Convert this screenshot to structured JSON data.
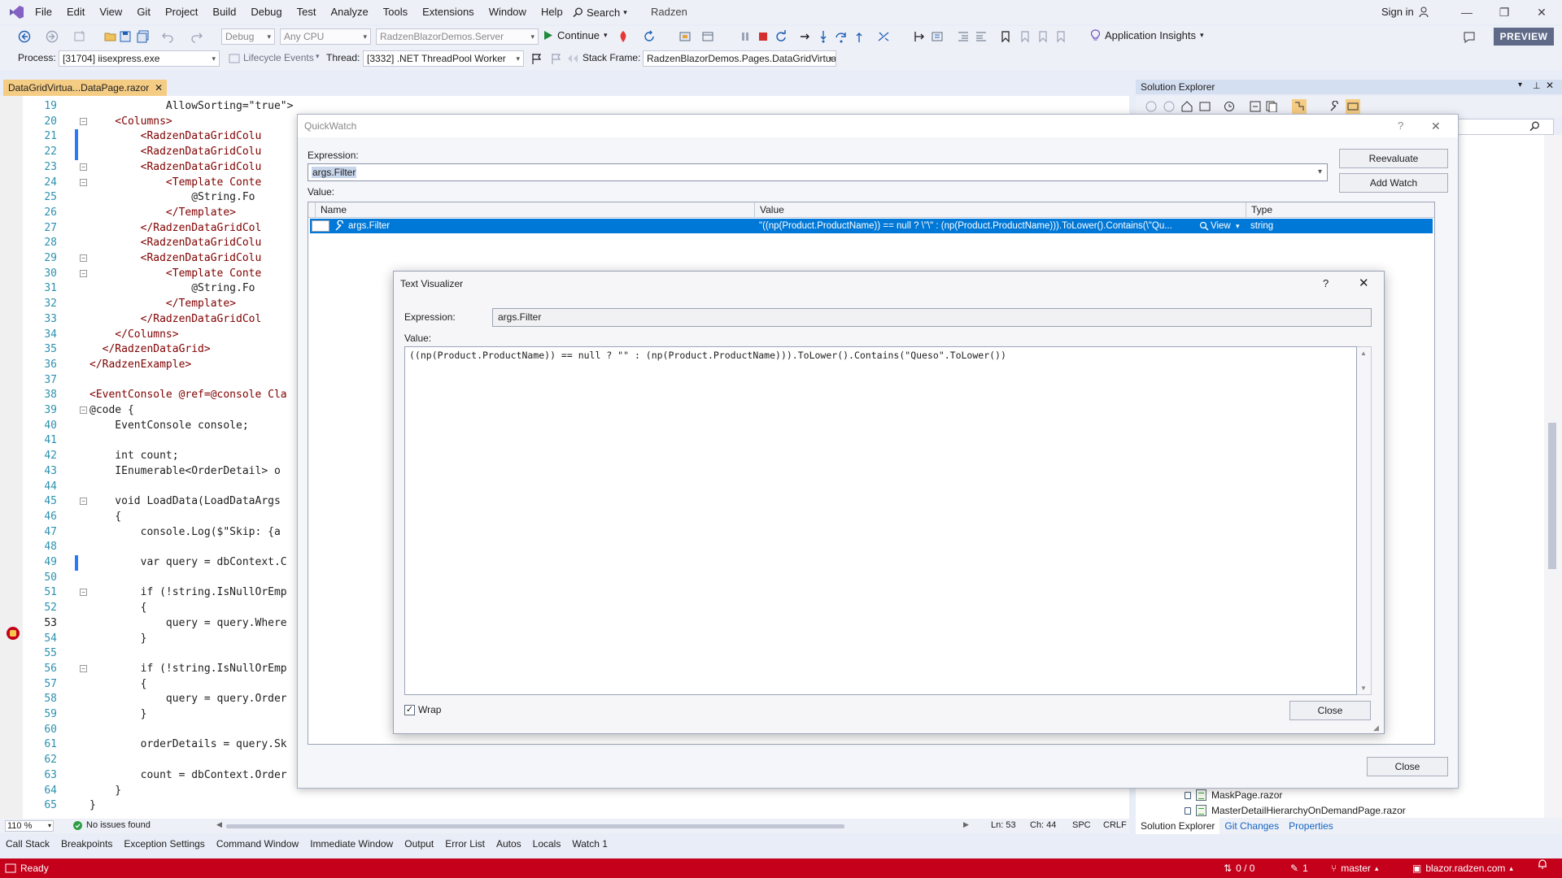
{
  "menubar": {
    "items": [
      "File",
      "Edit",
      "View",
      "Git",
      "Project",
      "Build",
      "Debug",
      "Test",
      "Analyze",
      "Tools",
      "Extensions",
      "Window",
      "Help"
    ],
    "search_label": "Search",
    "solution_name": "Radzen",
    "sign_in": "Sign in"
  },
  "toolbar1": {
    "config": "Debug",
    "platform": "Any CPU",
    "startup_project": "RadzenBlazorDemos.Server",
    "continue_label": "Continue",
    "app_insights": "Application Insights",
    "preview": "PREVIEW"
  },
  "toolbar2": {
    "process_label": "Process:",
    "process_value": "[31704] iisexpress.exe",
    "lifecycle": "Lifecycle Events",
    "thread_label": "Thread:",
    "thread_value": "[3332] .NET ThreadPool Worker",
    "stackframe_label": "Stack Frame:",
    "stackframe_value": "RadzenBlazorDemos.Pages.DataGridVirtua"
  },
  "editor": {
    "tab_title": "DataGridVirtua...DataPage.razor",
    "current_line": "53",
    "lines": [
      {
        "n": "19",
        "t": "            AllowSorting=\"true\">"
      },
      {
        "n": "20",
        "t": "    <Columns>"
      },
      {
        "n": "21",
        "t": "        <RadzenDataGridColu"
      },
      {
        "n": "22",
        "t": "        <RadzenDataGridColu"
      },
      {
        "n": "23",
        "t": "        <RadzenDataGridColu"
      },
      {
        "n": "24",
        "t": "            <Template Conte"
      },
      {
        "n": "25",
        "t": "                @String.Fo"
      },
      {
        "n": "26",
        "t": "            </Template>"
      },
      {
        "n": "27",
        "t": "        </RadzenDataGridCol"
      },
      {
        "n": "28",
        "t": "        <RadzenDataGridColu"
      },
      {
        "n": "29",
        "t": "        <RadzenDataGridColu"
      },
      {
        "n": "30",
        "t": "            <Template Conte"
      },
      {
        "n": "31",
        "t": "                @String.Fo"
      },
      {
        "n": "32",
        "t": "            </Template>"
      },
      {
        "n": "33",
        "t": "        </RadzenDataGridCol"
      },
      {
        "n": "34",
        "t": "    </Columns>"
      },
      {
        "n": "35",
        "t": "  </RadzenDataGrid>"
      },
      {
        "n": "36",
        "t": "</RadzenExample>"
      },
      {
        "n": "37",
        "t": ""
      },
      {
        "n": "38",
        "t": "<EventConsole @ref=@console Cla"
      },
      {
        "n": "39",
        "t": "@code {"
      },
      {
        "n": "40",
        "t": "    EventConsole console;"
      },
      {
        "n": "41",
        "t": ""
      },
      {
        "n": "42",
        "t": "    int count;"
      },
      {
        "n": "43",
        "t": "    IEnumerable<OrderDetail> o"
      },
      {
        "n": "44",
        "t": ""
      },
      {
        "n": "45",
        "t": "    void LoadData(LoadDataArgs"
      },
      {
        "n": "46",
        "t": "    {"
      },
      {
        "n": "47",
        "t": "        console.Log($\"Skip: {a"
      },
      {
        "n": "48",
        "t": ""
      },
      {
        "n": "49",
        "t": "        var query = dbContext.C"
      },
      {
        "n": "50",
        "t": ""
      },
      {
        "n": "51",
        "t": "        if (!string.IsNullOrEmp"
      },
      {
        "n": "52",
        "t": "        {"
      },
      {
        "n": "53",
        "t": "            query = query.Where"
      },
      {
        "n": "54",
        "t": "        }"
      },
      {
        "n": "55",
        "t": ""
      },
      {
        "n": "56",
        "t": "        if (!string.IsNullOrEmp"
      },
      {
        "n": "57",
        "t": "        {"
      },
      {
        "n": "58",
        "t": "            query = query.Order"
      },
      {
        "n": "59",
        "t": "        }"
      },
      {
        "n": "60",
        "t": ""
      },
      {
        "n": "61",
        "t": "        orderDetails = query.Sk"
      },
      {
        "n": "62",
        "t": ""
      },
      {
        "n": "63",
        "t": "        count = dbContext.Order"
      },
      {
        "n": "64",
        "t": "    }"
      },
      {
        "n": "65",
        "t": "}"
      }
    ],
    "status": {
      "zoom": "110 %",
      "issues": "No issues found",
      "ln": "Ln: 53",
      "ch": "Ch: 44",
      "spc": "SPC",
      "crlf": "CRLF"
    }
  },
  "solution_explorer": {
    "title": "Solution Explorer",
    "rows": [
      "MaskPage.razor",
      "MasterDetailHierarchyOnDemandPage.razor"
    ],
    "tabs": [
      "Solution Explorer",
      "Git Changes",
      "Properties"
    ]
  },
  "quickwatch": {
    "title": "QuickWatch",
    "help": "?",
    "expression_label": "Expression:",
    "expression_value": "args.Filter",
    "value_label": "Value:",
    "reevaluate": "Reevaluate",
    "add_watch": "Add Watch",
    "columns": [
      "Name",
      "Value",
      "Type"
    ],
    "row": {
      "name": "args.Filter",
      "value": "\"((np(Product.ProductName)) == null ? \\\"\\\" : (np(Product.ProductName))).ToLower().Contains(\\\"Qu...",
      "view": "View",
      "type": "string"
    },
    "close": "Close"
  },
  "text_visualizer": {
    "title": "Text Visualizer",
    "help": "?",
    "expression_label": "Expression:",
    "expression_value": "args.Filter",
    "value_label": "Value:",
    "value_text": "((np(Product.ProductName)) == null ? \"\" : (np(Product.ProductName))).ToLower().Contains(\"Queso\".ToLower())",
    "wrap_label": "Wrap",
    "wrap_checked": "✓",
    "close": "Close"
  },
  "tool_tabs": [
    "Call Stack",
    "Breakpoints",
    "Exception Settings",
    "Command Window",
    "Immediate Window",
    "Output",
    "Error List",
    "Autos",
    "Locals",
    "Watch 1"
  ],
  "statusbar": {
    "ready": "Ready",
    "commits": "0 / 0",
    "pending": "1",
    "branch": "master",
    "repo": "blazor.radzen.com"
  },
  "colors": {
    "statusbar": "#c4001b",
    "accent_selection": "#0078d7",
    "doc_tab": "#f5cc84"
  }
}
